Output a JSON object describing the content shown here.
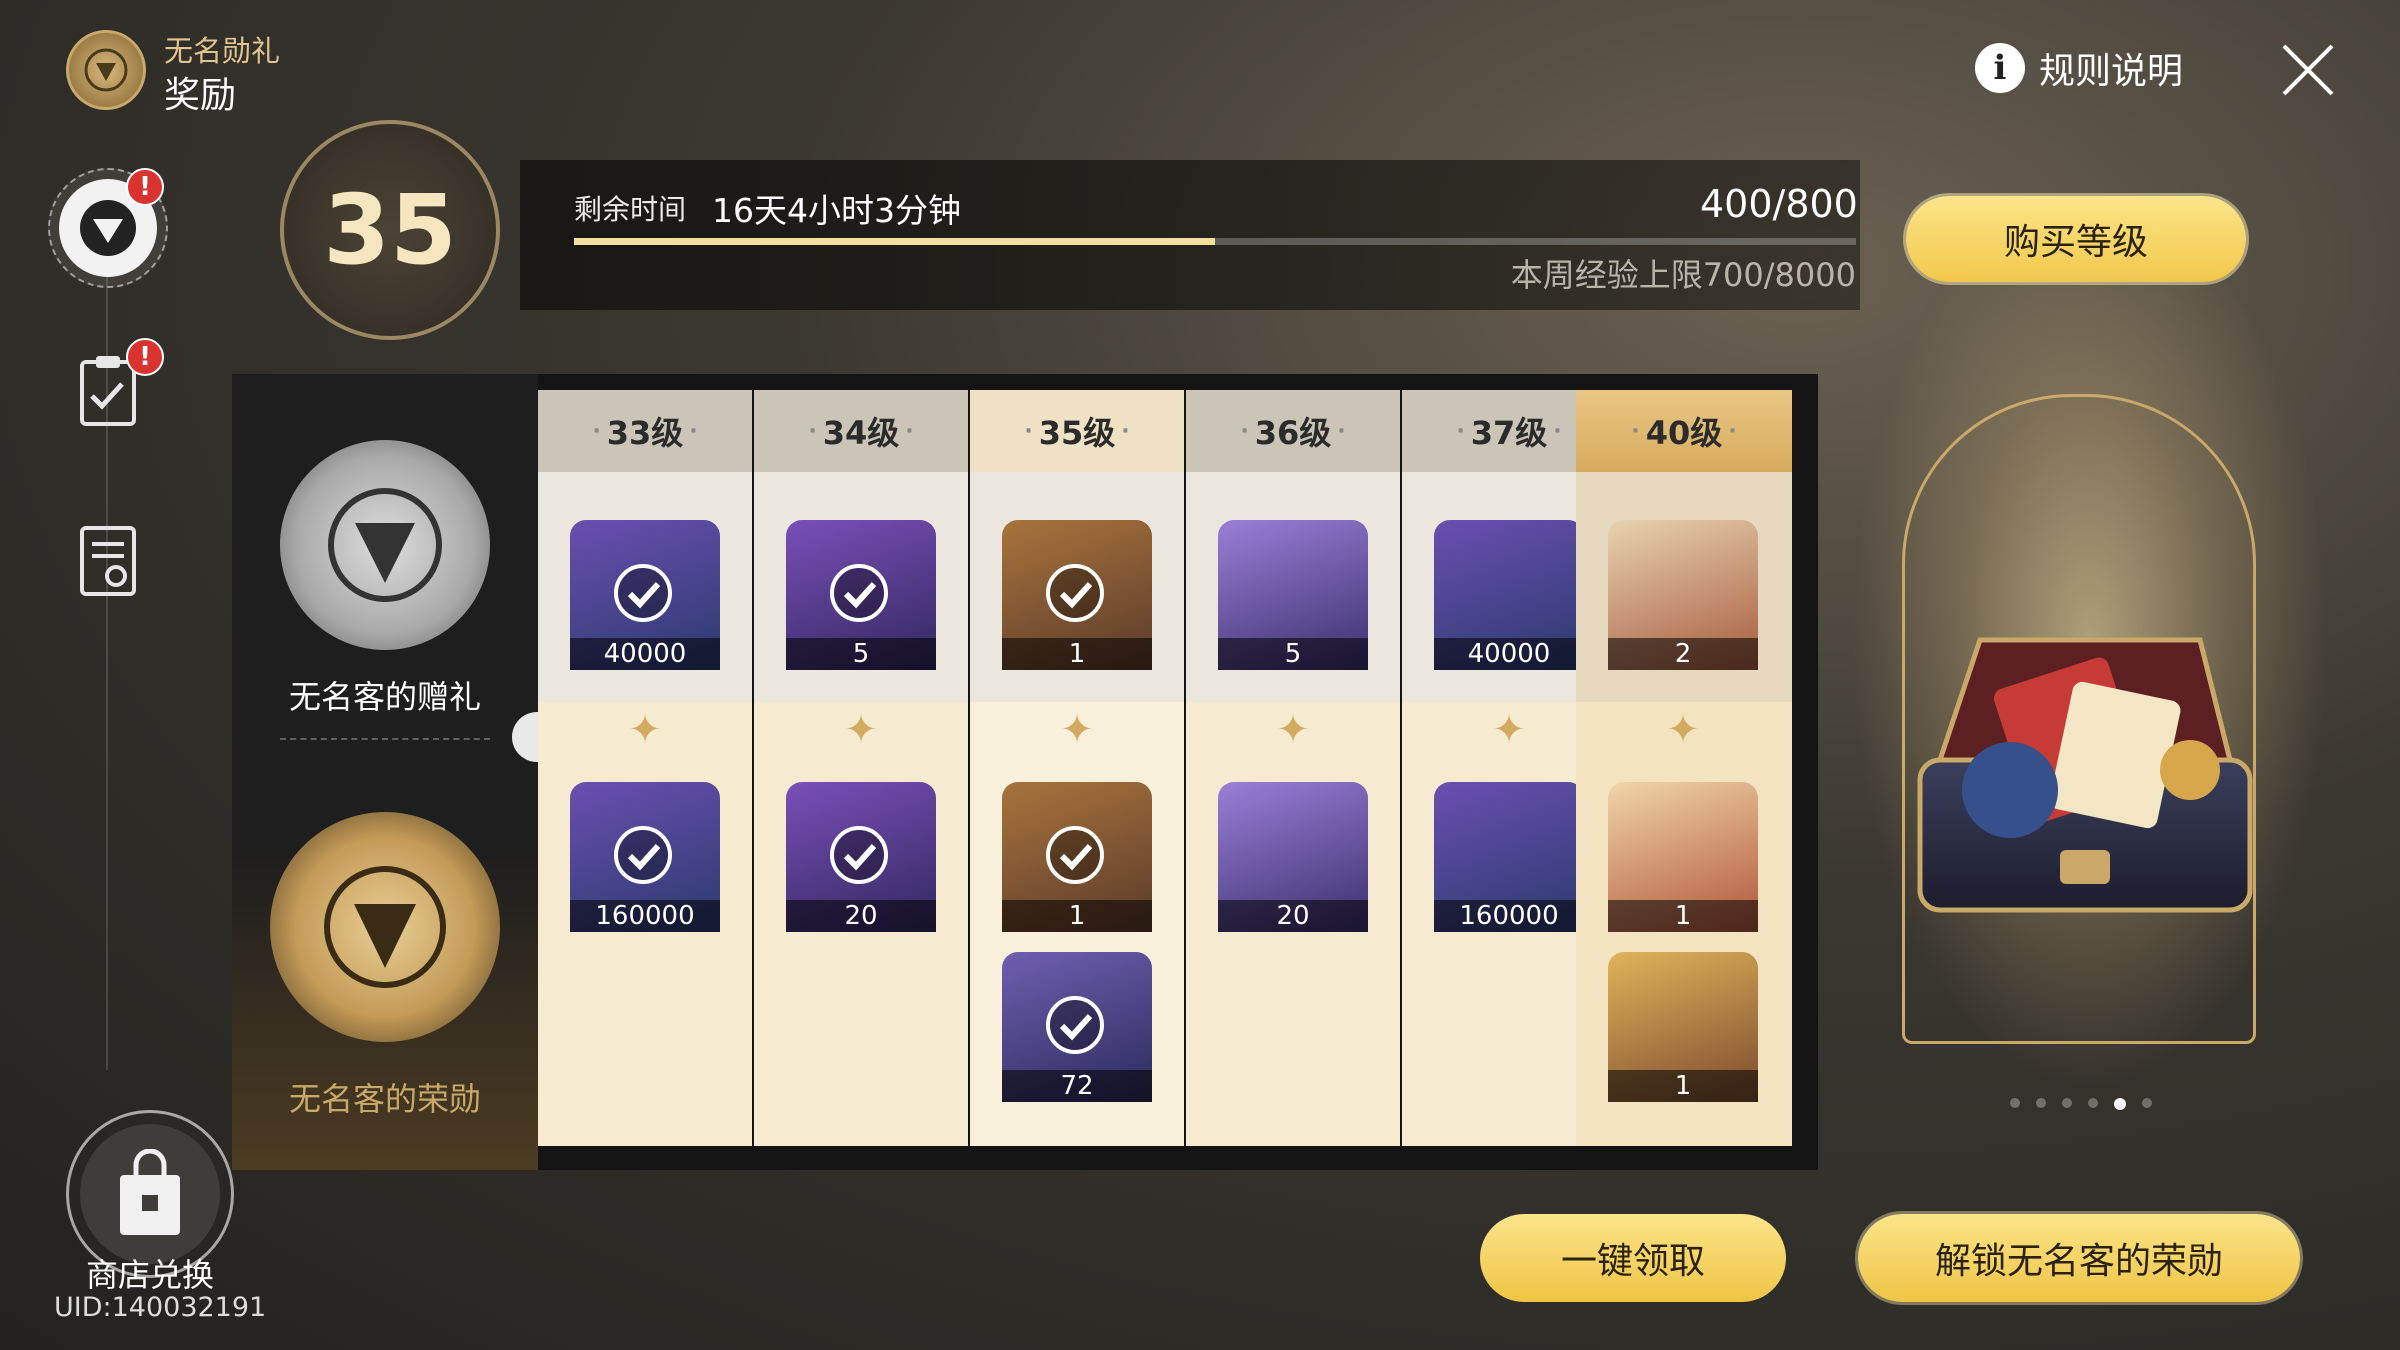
{
  "header": {
    "subtitle": "无名勋礼",
    "title": "奖励",
    "rules_label": "规则说明"
  },
  "nav": {
    "shop_label": "商店兑换",
    "uid": "UID:140032191",
    "badge_mark": "!"
  },
  "level": {
    "current": "35"
  },
  "progress": {
    "remaining_label": "剩余时间",
    "remaining_value": "16天4小时3分钟",
    "xp": "400/800",
    "xp_fraction": 0.5,
    "weekly_cap": "本周经验上限700/8000"
  },
  "buttons": {
    "buy_level": "购买等级",
    "claim_all": "一键领取",
    "unlock_paid": "解锁无名客的荣勋"
  },
  "tracks": {
    "free_label": "无名客的赠礼",
    "paid_label": "无名客的荣勋"
  },
  "columns": [
    {
      "level": "33级",
      "free": [
        {
          "qty": "40000",
          "icon": "credit-card-icon",
          "claimed": true
        }
      ],
      "paid": [
        {
          "qty": "160000",
          "icon": "credit-card-icon",
          "claimed": true
        }
      ]
    },
    {
      "level": "34级",
      "free": [
        {
          "qty": "5",
          "icon": "book-icon",
          "claimed": true
        }
      ],
      "paid": [
        {
          "qty": "20",
          "icon": "book-icon",
          "claimed": true
        }
      ]
    },
    {
      "level": "35级",
      "free": [
        {
          "qty": "1",
          "icon": "ore-orb-icon",
          "claimed": true
        }
      ],
      "paid": [
        {
          "qty": "1",
          "icon": "ore-orb-icon",
          "claimed": true
        },
        {
          "qty": "72",
          "icon": "purple-orb-icon",
          "claimed": true
        }
      ]
    },
    {
      "level": "36级",
      "free": [
        {
          "qty": "5",
          "icon": "lantern-icon",
          "claimed": false
        }
      ],
      "paid": [
        {
          "qty": "20",
          "icon": "lantern-icon",
          "claimed": false
        }
      ]
    },
    {
      "level": "37级",
      "free": [
        {
          "qty": "40000",
          "icon": "credit-card-icon",
          "claimed": false
        }
      ],
      "paid": [
        {
          "qty": "160000",
          "icon": "credit-card-icon",
          "claimed": false
        }
      ]
    },
    {
      "level": "40级",
      "free": [
        {
          "qty": "2",
          "icon": "star-pass-icon",
          "claimed": false
        }
      ],
      "paid": [
        {
          "qty": "1",
          "icon": "special-pass-icon",
          "claimed": false
        },
        {
          "qty": "1",
          "icon": "golden-cube-icon",
          "claimed": false
        }
      ]
    }
  ],
  "colors": {
    "accent": "#f2c84b",
    "gold": "#c9a86a",
    "alert": "#d9322f"
  }
}
